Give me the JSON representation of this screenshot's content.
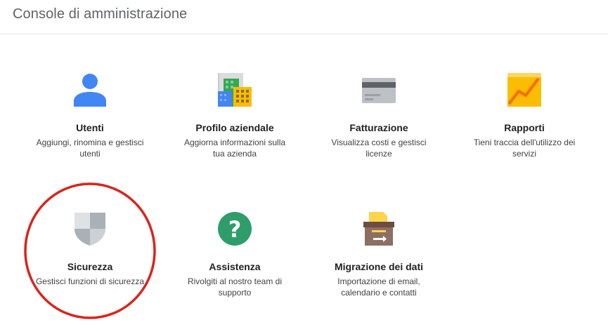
{
  "header": {
    "title": "Console di amministrazione"
  },
  "tiles": [
    {
      "icon": "user-icon",
      "name": "Utenti",
      "desc": "Aggiungi, rinomina e gestisci utenti"
    },
    {
      "icon": "buildings-icon",
      "name": "Profilo aziendale",
      "desc": "Aggiorna informazioni sulla tua azienda"
    },
    {
      "icon": "credit-card-icon",
      "name": "Fatturazione",
      "desc": "Visualizza costi e gestisci licenze"
    },
    {
      "icon": "trend-chart-icon",
      "name": "Rapporti",
      "desc": "Tieni traccia dell'utilizzo dei servizi"
    },
    {
      "icon": "shield-icon",
      "name": "Sicurezza",
      "desc": "Gestisci funzioni di sicurezza"
    },
    {
      "icon": "question-mark-icon",
      "name": "Assistenza",
      "desc": "Rivolgiti al nostro team di supporto"
    },
    {
      "icon": "archive-box-icon",
      "name": "Migrazione dei dati",
      "desc": "Importazione di email, calendario e contatti"
    }
  ],
  "colors": {
    "user_blue": "#4285f4",
    "help_green": "#2e9d6a",
    "annotation_red": "#d9251c"
  }
}
